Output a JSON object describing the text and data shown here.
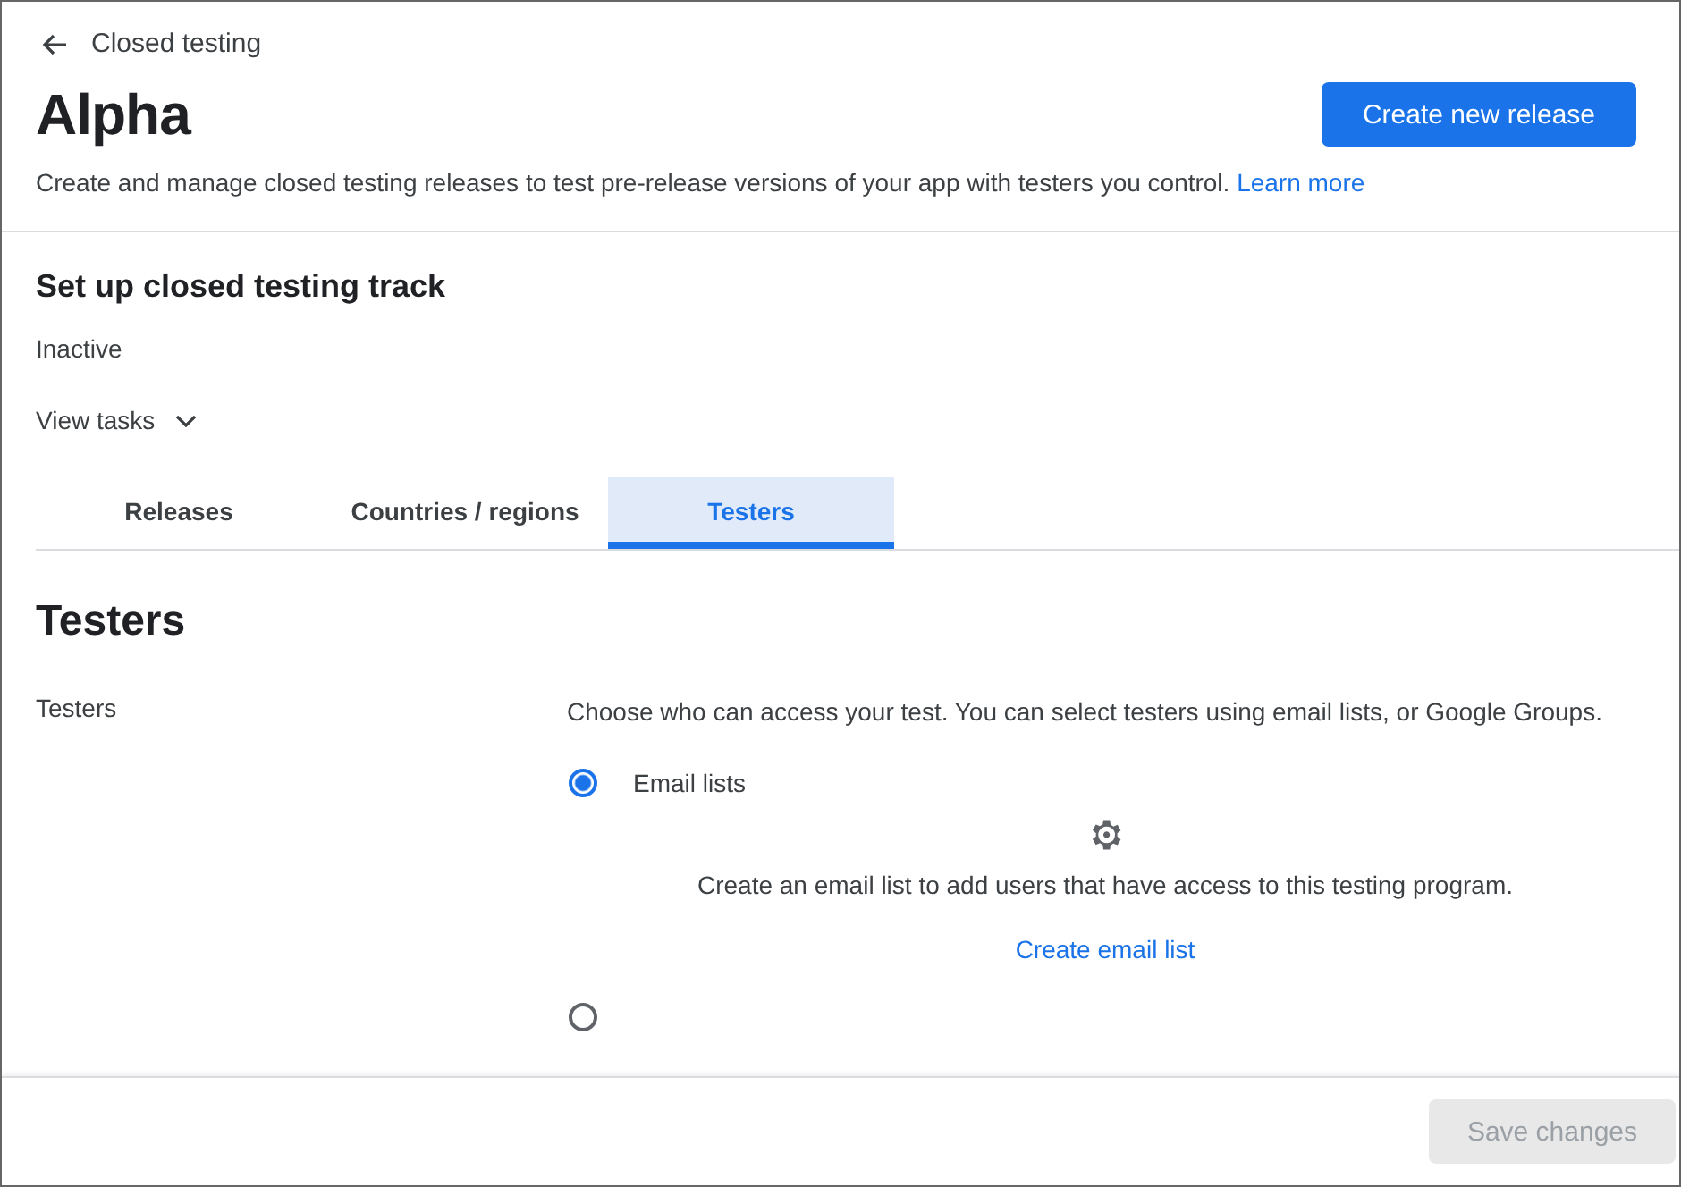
{
  "back_link": {
    "label": "Closed testing"
  },
  "header": {
    "title": "Alpha",
    "primary_button": "Create new release",
    "description": "Create and manage closed testing releases to test pre-release versions of your app with testers you control.",
    "learn_more": "Learn more"
  },
  "setup": {
    "title": "Set up closed testing track",
    "status": "Inactive",
    "toggle": {
      "label": "View tasks",
      "expanded": false
    }
  },
  "tabs": [
    {
      "label": "Releases",
      "selected": false
    },
    {
      "label": "Countries / regions",
      "selected": false
    },
    {
      "label": "Testers",
      "selected": true
    }
  ],
  "section": {
    "title": "Testers",
    "field_label": "Testers",
    "intro": "Choose who can access your test. You can select testers using email lists, or Google Groups.",
    "options": [
      {
        "label": "Email lists",
        "selected": true,
        "empty_state": {
          "message": "Create an email list to add users that have access to this testing program.",
          "action": "Create email list"
        }
      },
      {
        "selected": false
      }
    ]
  },
  "footer": {
    "save_button": {
      "label": "Save changes",
      "disabled": true
    }
  }
}
